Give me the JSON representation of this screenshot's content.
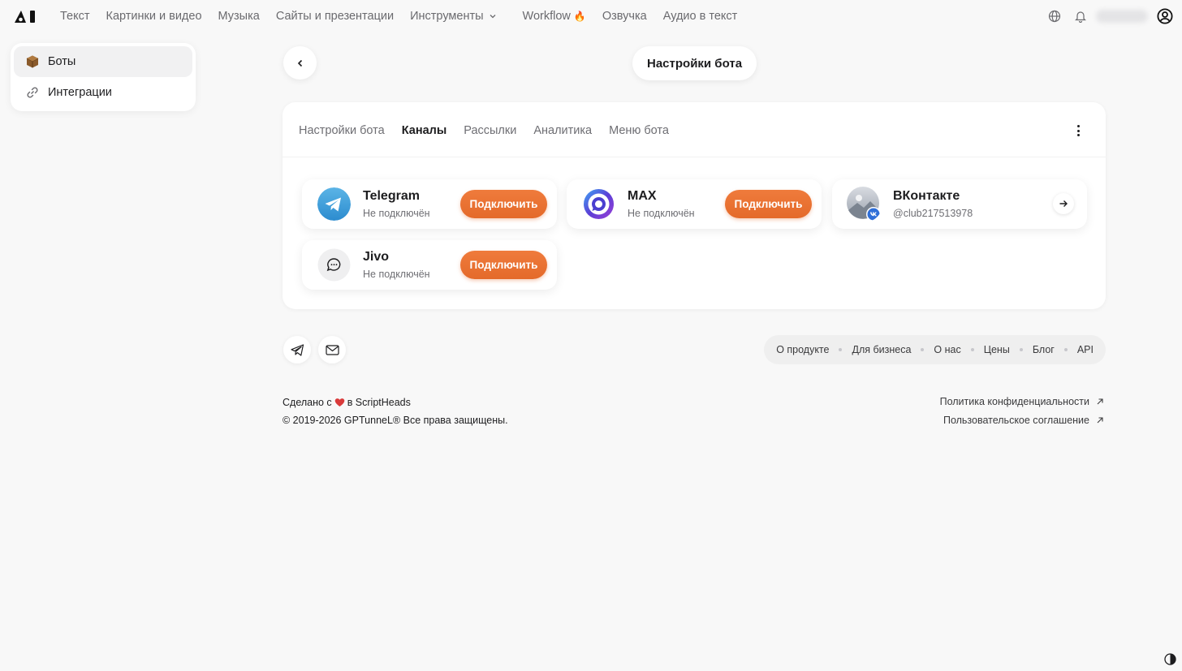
{
  "nav": {
    "items": [
      "Текст",
      "Картинки и видео",
      "Музыка",
      "Сайты и презентации",
      "Инструменты"
    ],
    "workflow": "Workflow",
    "workflow_emoji": "🔥",
    "voice": "Озвучка",
    "audio_to_text": "Аудио в текст"
  },
  "sidebar": {
    "items": [
      {
        "label": "Боты",
        "icon": "box-icon",
        "active": true
      },
      {
        "label": "Интеграции",
        "icon": "link-icon",
        "active": false
      }
    ]
  },
  "header": {
    "title": "Настройки бота"
  },
  "tabs": [
    {
      "label": "Настройки бота",
      "active": false
    },
    {
      "label": "Каналы",
      "active": true
    },
    {
      "label": "Рассылки",
      "active": false
    },
    {
      "label": "Аналитика",
      "active": false
    },
    {
      "label": "Меню бота",
      "active": false
    }
  ],
  "channels": [
    {
      "name": "Telegram",
      "status": "Не подключён",
      "action": "Подключить",
      "icon": "telegram-icon"
    },
    {
      "name": "MAX",
      "status": "Не подключён",
      "action": "Подключить",
      "icon": "max-icon"
    },
    {
      "name": "ВКонтакте",
      "status": "@club217513978",
      "icon": "vk-icon"
    },
    {
      "name": "Jivo",
      "status": "Не подключён",
      "action": "Подключить",
      "icon": "chat-icon"
    }
  ],
  "footer": {
    "links": [
      "О продукте",
      "Для бизнеса",
      "О нас",
      "Цены",
      "Блог",
      "API"
    ],
    "made_prefix": "Сделано с",
    "made_suffix": "в ScriptHeads",
    "copyright": "© 2019-2026 GPTunneL® Все права защищены.",
    "privacy": "Политика конфиденциальности",
    "terms": "Пользовательское соглашение"
  },
  "colors": {
    "accent": "#e8702f",
    "telegram": "#3a9bd9",
    "max": "#5b3fd6",
    "vk": "#2f6fd8"
  }
}
